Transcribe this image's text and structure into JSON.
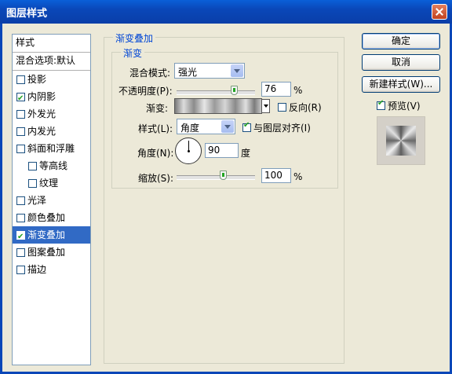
{
  "window": {
    "title": "图层样式"
  },
  "sidebar": {
    "header": "样式",
    "blend_options": "混合选项:默认",
    "items": [
      {
        "label": "投影",
        "checked": false,
        "sub": false,
        "selected": false
      },
      {
        "label": "内阴影",
        "checked": true,
        "sub": false,
        "selected": false
      },
      {
        "label": "外发光",
        "checked": false,
        "sub": false,
        "selected": false
      },
      {
        "label": "内发光",
        "checked": false,
        "sub": false,
        "selected": false
      },
      {
        "label": "斜面和浮雕",
        "checked": false,
        "sub": false,
        "selected": false
      },
      {
        "label": "等高线",
        "checked": false,
        "sub": true,
        "selected": false
      },
      {
        "label": "纹理",
        "checked": false,
        "sub": true,
        "selected": false
      },
      {
        "label": "光泽",
        "checked": false,
        "sub": false,
        "selected": false
      },
      {
        "label": "颜色叠加",
        "checked": false,
        "sub": false,
        "selected": false
      },
      {
        "label": "渐变叠加",
        "checked": true,
        "sub": false,
        "selected": true
      },
      {
        "label": "图案叠加",
        "checked": false,
        "sub": false,
        "selected": false
      },
      {
        "label": "描边",
        "checked": false,
        "sub": false,
        "selected": false
      }
    ]
  },
  "panel": {
    "group_title": "渐变叠加",
    "subgroup_title": "渐变",
    "blend_mode": {
      "label": "混合模式:",
      "value": "强光"
    },
    "opacity": {
      "label": "不透明度(P):",
      "value": "76",
      "unit": "%",
      "level": 0.76
    },
    "gradient": {
      "label": "渐变:",
      "reverse_label": "反向(R)",
      "reverse_checked": false
    },
    "style": {
      "label": "样式(L):",
      "value": "角度",
      "align_label": "与图层对齐(I)",
      "align_checked": true
    },
    "angle": {
      "label": "角度(N):",
      "value": "90",
      "unit": "度",
      "degrees": 90
    },
    "scale": {
      "label": "缩放(S):",
      "value": "100",
      "unit": "%",
      "level": 0.6
    }
  },
  "buttons": {
    "ok": "确定",
    "cancel": "取消",
    "new_style": "新建样式(W)...",
    "preview_label": "预览(V)",
    "preview_checked": true
  }
}
